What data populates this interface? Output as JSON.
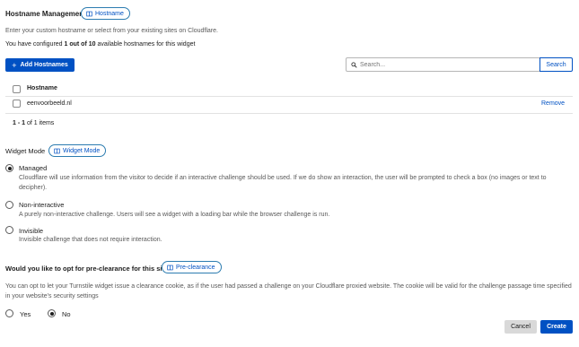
{
  "hostname_section": {
    "title": "Hostname Management",
    "pill_label": "Hostname",
    "description": "Enter your custom hostname or select from your existing sites on Cloudflare.",
    "usage_prefix": "You have configured ",
    "usage_count": "1 out of 10",
    "usage_suffix": " available hostnames for this widget",
    "add_button": "Add Hostnames",
    "search_placeholder": "Search...",
    "search_button": "Search",
    "table": {
      "column_header": "Hostname",
      "rows": [
        {
          "hostname": "eenvoorbeeld.nl",
          "action": "Remove"
        }
      ]
    },
    "pagination_range": "1 - 1",
    "pagination_suffix": " of 1 items"
  },
  "widget_mode": {
    "title": "Widget Mode",
    "pill_label": "Widget Mode",
    "options": [
      {
        "label": "Managed",
        "description": "Cloudflare will use information from the visitor to decide if an interactive challenge should be used. If we do show an interaction, the user will be prompted to check a box (no images or text to decipher).",
        "selected": true
      },
      {
        "label": "Non-interactive",
        "description": "A purely non-interactive challenge. Users will see a widget with a loading bar while the browser challenge is run.",
        "selected": false
      },
      {
        "label": "Invisible",
        "description": "Invisible challenge that does not require interaction.",
        "selected": false
      }
    ]
  },
  "preclearance": {
    "question": "Would you like to opt for pre-clearance for this site?",
    "pill_label": "Pre-clearance",
    "description": "You can opt to let your Turnstile widget issue a clearance cookie, as if the user had passed a challenge on your Cloudflare proxied website. The cookie will be valid for the challenge passage time specified in your website's security settings",
    "yes_label": "Yes",
    "no_label": "No",
    "selected": "No"
  },
  "footer": {
    "cancel_label": "Cancel",
    "create_label": "Create"
  },
  "colors": {
    "primary": "#0051c3",
    "pill_border": "#2c7cb0",
    "cancel_bg": "#d9d9d9"
  }
}
